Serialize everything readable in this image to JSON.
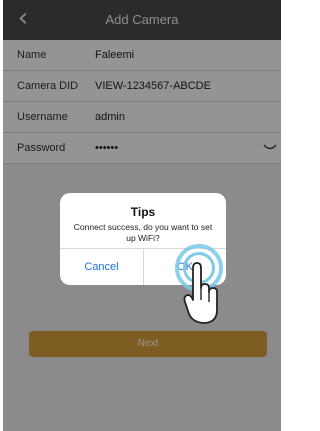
{
  "nav": {
    "back_icon": "chevron-left-icon",
    "title": "Add Camera"
  },
  "form": {
    "rows": [
      {
        "label": "Name",
        "value": "Faleemi"
      },
      {
        "label": "Camera DID",
        "value": "VIEW-1234567-ABCDE"
      },
      {
        "label": "Username",
        "value": "admin"
      },
      {
        "label": "Password",
        "value": "••••••",
        "icon": "eye-icon"
      }
    ]
  },
  "next_label": "Next",
  "dialog": {
    "title": "Tips",
    "message": "Connect success, do you want to set up WiFi?",
    "cancel_label": "Cancel",
    "ok_label": "OK"
  },
  "colors": {
    "navbar": "#4a4a4a",
    "accent": "#d9a13b",
    "dialog_button": "#1e73d8",
    "tap_ripple": "#78c8e8"
  }
}
